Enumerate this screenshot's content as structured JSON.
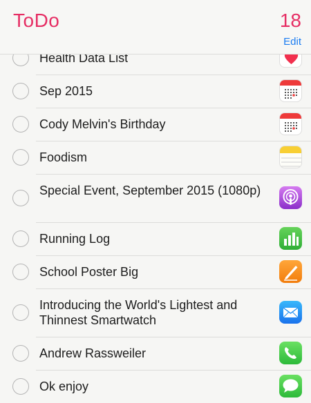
{
  "header": {
    "title": "ToDo",
    "count": "18",
    "edit_label": "Edit"
  },
  "items": [
    {
      "text": "Health Data List",
      "app_icon": "health-icon"
    },
    {
      "text": "Sep 2015",
      "app_icon": "calendar-icon"
    },
    {
      "text": "Cody Melvin's Birthday",
      "app_icon": "calendar-icon"
    },
    {
      "text": "Foodism",
      "app_icon": "notes-icon"
    },
    {
      "text": "Special Event, September 2015 (1080p)",
      "app_icon": "podcasts-icon"
    },
    {
      "text": "Running Log",
      "app_icon": "numbers-icon"
    },
    {
      "text": "School Poster Big",
      "app_icon": "pages-icon"
    },
    {
      "text": "Introducing the World's Lightest and Thinnest Smartwatch",
      "app_icon": "mail-icon"
    },
    {
      "text": "Andrew Rassweiler",
      "app_icon": "phone-icon"
    },
    {
      "text": "Ok enjoy",
      "app_icon": "messages-icon"
    }
  ],
  "colors": {
    "accent": "#e62e64",
    "link": "#1a7cf2"
  }
}
